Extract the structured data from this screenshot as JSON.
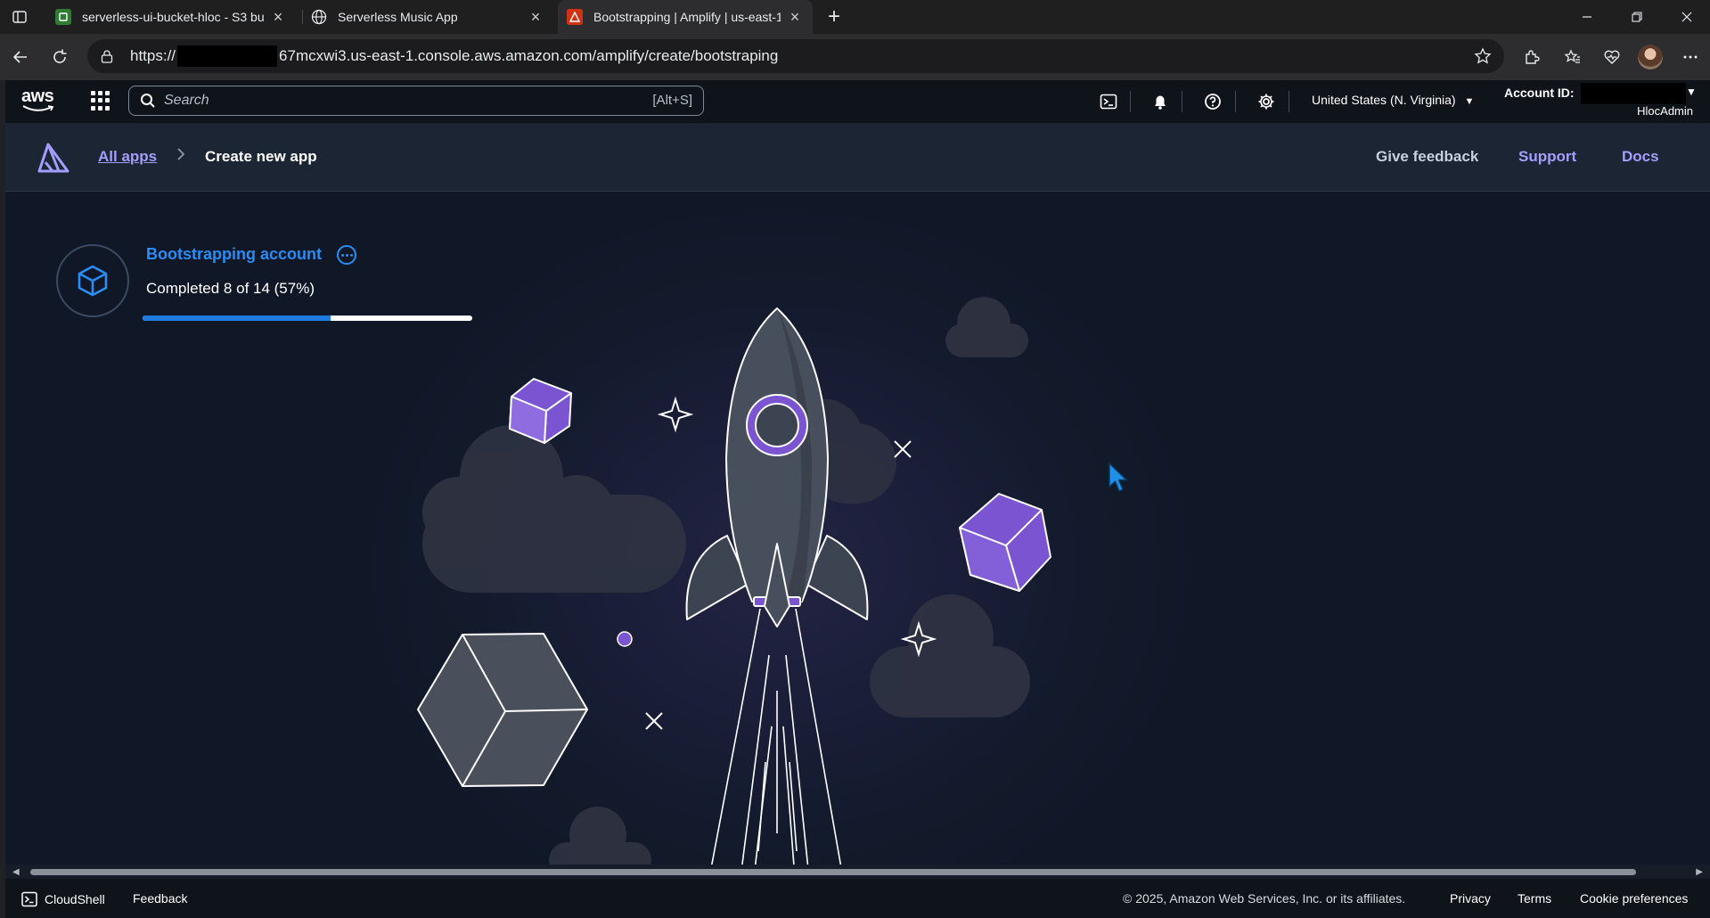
{
  "browser": {
    "tabs": [
      {
        "title": "serverless-ui-bucket-hloc - S3 bucket",
        "favicon": "s3-icon",
        "active": false
      },
      {
        "title": "Serverless Music App",
        "favicon": "globe-icon",
        "active": false
      },
      {
        "title": "Bootstrapping | Amplify | us-east-1",
        "favicon": "amplify-icon",
        "active": true
      }
    ],
    "url_prefix": "https://",
    "url_rest": "67mcxwi3.us-east-1.console.aws.amazon.com/amplify/create/bootstraping"
  },
  "aws_nav": {
    "logo_text": "aws",
    "search_placeholder": "Search",
    "search_shortcut": "[Alt+S]",
    "region": "United States (N. Virginia)",
    "account_label": "Account ID:",
    "user": "HlocAdmin"
  },
  "amplify_header": {
    "breadcrumb_link": "All apps",
    "breadcrumb_current": "Create new app",
    "links": [
      "Give feedback",
      "Support",
      "Docs"
    ]
  },
  "bootstrap": {
    "title": "Bootstrapping account",
    "status": "Completed 8 of 14 (57%)",
    "progress_fraction": 0.57
  },
  "footer": {
    "cloudshell": "CloudShell",
    "feedback": "Feedback",
    "copyright": "© 2025, Amazon Web Services, Inc. or its affiliates.",
    "privacy": "Privacy",
    "terms": "Terms",
    "cookies": "Cookie preferences"
  },
  "colors": {
    "accent_blue": "#2a8cf4",
    "link_purple": "#a49cff",
    "cube_purple": "#7b55d1"
  }
}
